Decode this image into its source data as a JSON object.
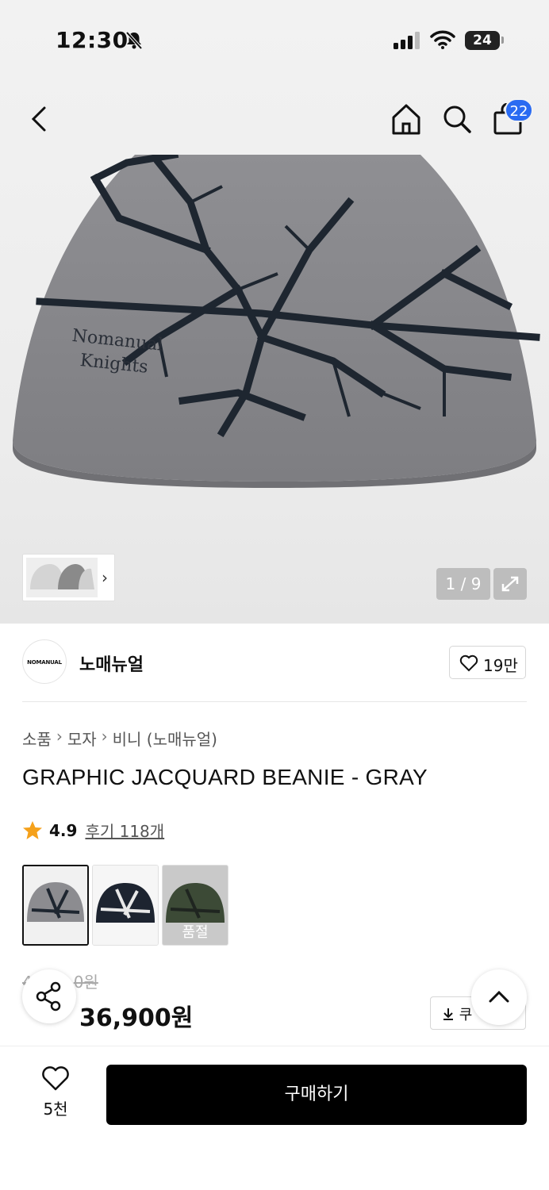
{
  "status_bar": {
    "time": "12:30",
    "battery": "24"
  },
  "header": {
    "cart_count": "22"
  },
  "gallery": {
    "counter": "1 / 9"
  },
  "brand": {
    "logo_text": "NOMANUAL",
    "name": "노매뉴얼",
    "likes": "19만"
  },
  "breadcrumb": [
    "소품",
    "모자",
    "비니 (노매뉴얼)"
  ],
  "product": {
    "title": "GRAPHIC JACQUARD BEANIE - GRAY",
    "rating": "4.9",
    "reviews": "후기 118개",
    "sold_out_label": "품절",
    "original_price": "4",
    "original_price_suffix": "0원",
    "sale_price": "36,900원",
    "coupon_label": "쿠"
  },
  "bottom": {
    "wish_count": "5천",
    "buy_label": "구매하기"
  },
  "colors": {
    "accent_blue": "#2a6bf2",
    "discount_red": "#f4361e",
    "star": "#f5a11b"
  }
}
